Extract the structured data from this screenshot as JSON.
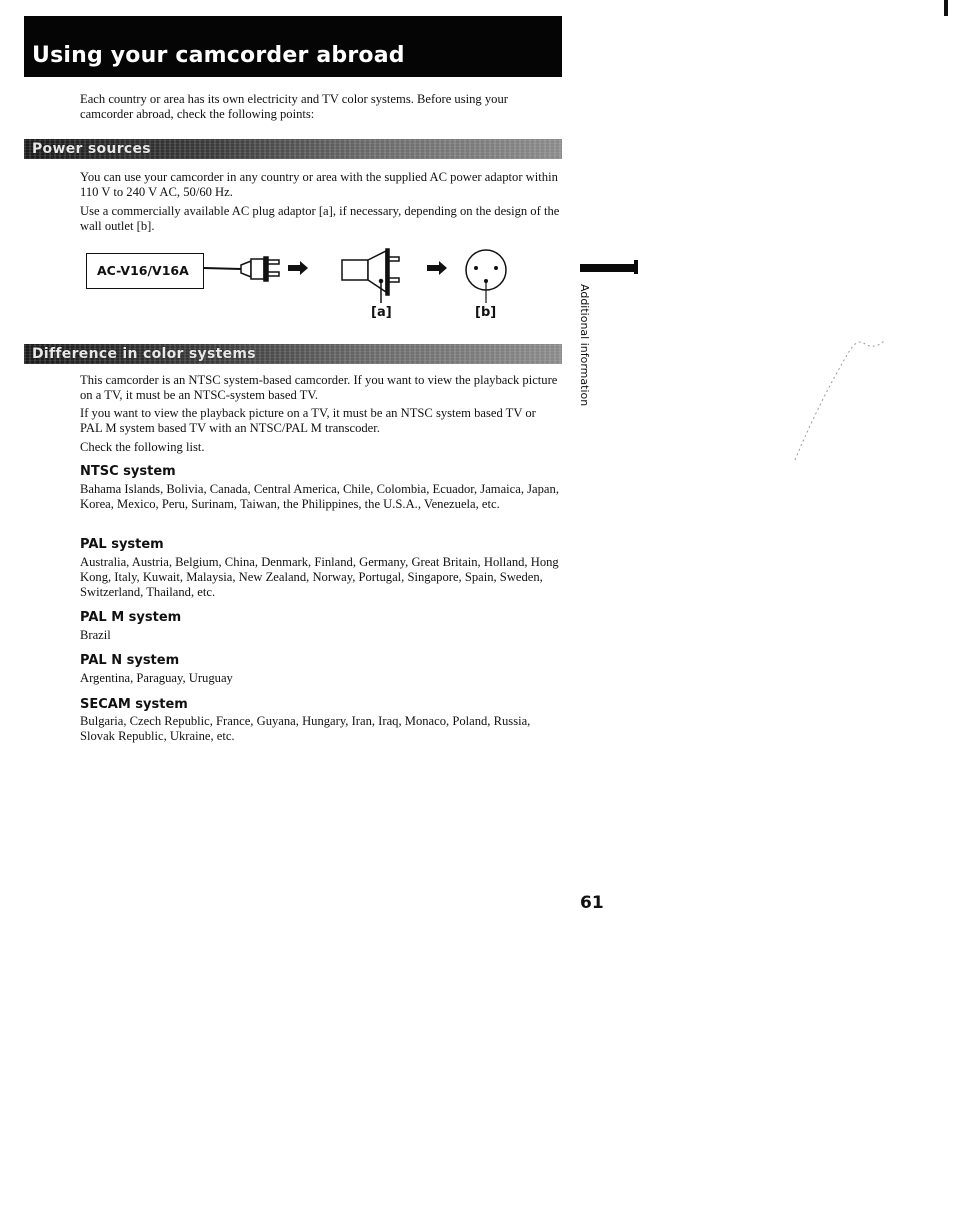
{
  "page": {
    "title": "Using your camcorder abroad",
    "intro": "Each country or area has its own electricity and TV color systems. Before using your camcorder abroad, check the following points:",
    "side_tab_label": "Additional information",
    "page_number": "61"
  },
  "power_sources": {
    "heading": "Power sources",
    "paragraphs": [
      "You can use your camcorder in any country or area with the supplied AC power adaptor within 110 V to 240 V AC, 50/60 Hz.",
      "Use a commercially available AC plug adaptor [a], if necessary, depending on the design of the wall outlet [b]."
    ],
    "diagram": {
      "adaptor_model": "AC-V16/V16A",
      "label_a": "[a]",
      "label_b": "[b]",
      "icons": [
        "ac-adaptor-box",
        "power-plug-icon",
        "arrow-right-icon",
        "plug-adaptor-icon",
        "arrow-right-icon",
        "wall-outlet-icon"
      ]
    }
  },
  "color_systems": {
    "heading": "Difference in color systems",
    "paragraphs": [
      "This camcorder is an NTSC system-based camcorder. If you want to view the playback picture on a TV, it must be an NTSC-system based TV.",
      "If you want to view the playback picture on a TV, it must be an NTSC system based TV or PAL M system based TV with an NTSC/PAL M transcoder.",
      "Check the following list."
    ],
    "systems": [
      {
        "name": "NTSC system",
        "countries": "Bahama Islands, Bolivia, Canada, Central America, Chile, Colombia, Ecuador, Jamaica, Japan, Korea, Mexico, Peru, Surinam, Taiwan, the Philippines, the U.S.A., Venezuela, etc."
      },
      {
        "name": "PAL system",
        "countries": "Australia, Austria, Belgium, China, Denmark, Finland, Germany, Great Britain, Holland, Hong Kong, Italy, Kuwait, Malaysia, New Zealand, Norway, Portugal, Singapore, Spain, Sweden, Switzerland, Thailand, etc."
      },
      {
        "name": "PAL M system",
        "countries": "Brazil"
      },
      {
        "name": "PAL N system",
        "countries": "Argentina, Paraguay, Uruguay"
      },
      {
        "name": "SECAM system",
        "countries": "Bulgaria, Czech Republic, France, Guyana, Hungary, Iran, Iraq, Monaco, Poland, Russia, Slovak Republic, Ukraine, etc."
      }
    ]
  }
}
